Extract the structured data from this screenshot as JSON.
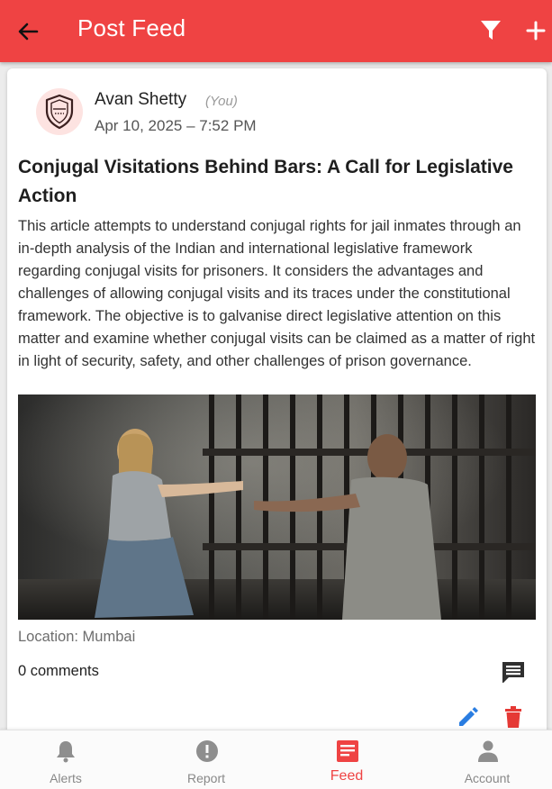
{
  "appbar": {
    "title": "Post Feed",
    "back_icon": "arrow-left-icon",
    "filter_icon": "filter-icon",
    "add_icon": "plus-icon",
    "color": "#ef4343"
  },
  "post": {
    "author": "Avan Shetty",
    "you_tag": "(You)",
    "date": "Apr 10, 2025 – 7:52 PM",
    "avatar_icon": "shield-icon",
    "title": "Conjugal Visitations Behind Bars: A Call for Legislative Action",
    "body": "This article attempts to understand conjugal rights for jail inmates through an in-depth analysis of the Indian and international legislative framework regarding conjugal visits for prisoners. It considers the advantages and challenges of allowing conjugal visits and its traces under the constitutional framework. The objective is to galvanise direct legislative attention on this matter and examine whether conjugal visits can be claimed as a matter of right in light of security, safety, and other challenges of prison governance.",
    "location": "Location: Mumbai",
    "comments": "0 comments",
    "comment_icon": "comment-icon",
    "edit_icon": "pencil-icon",
    "delete_icon": "trash-icon"
  },
  "nav": {
    "items": [
      {
        "label": "Alerts",
        "icon": "bell-icon"
      },
      {
        "label": "Report",
        "icon": "alert-circle-icon"
      },
      {
        "label": "Feed",
        "icon": "document-icon",
        "active": true
      },
      {
        "label": "Account",
        "icon": "person-icon"
      }
    ],
    "active_color": "#ef4343"
  }
}
